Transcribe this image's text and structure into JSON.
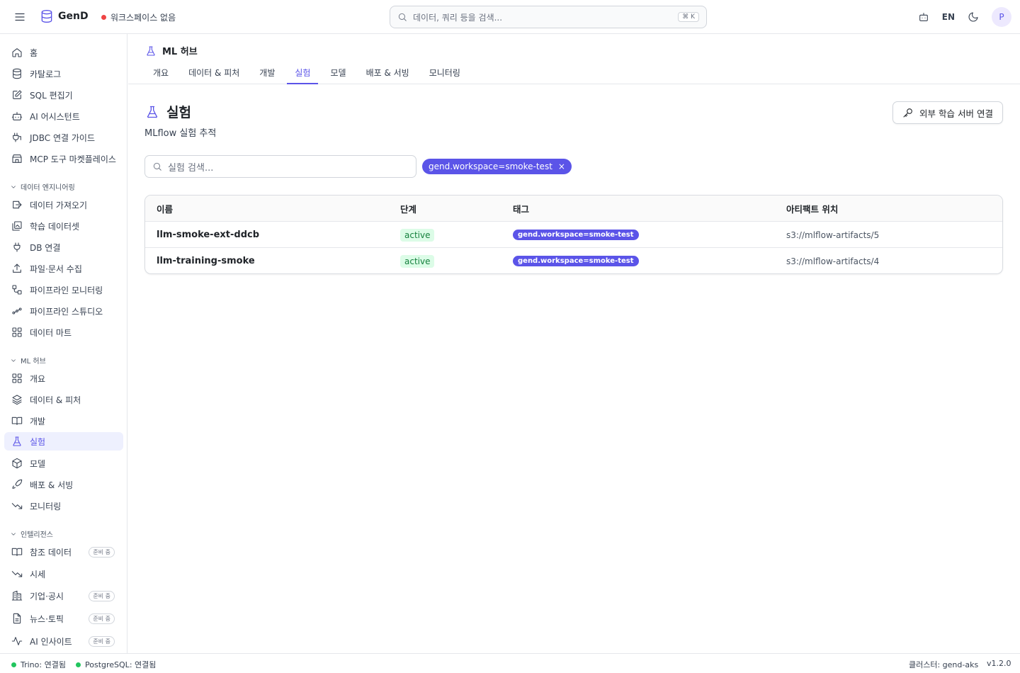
{
  "app": {
    "name": "GenD",
    "workspace_status": "워크스페이스 없음",
    "status_dot_color": "#ef4444",
    "brand_color": "#5b54e8"
  },
  "search": {
    "placeholder": "데이터, 쿼리 등을 검색...",
    "shortcut": "⌘ K"
  },
  "header_right": {
    "lang": "EN",
    "avatar_initial": "P"
  },
  "sidebar": {
    "top_items": [
      {
        "label": "홈",
        "icon": "home-icon"
      },
      {
        "label": "카탈로그",
        "icon": "database-icon"
      },
      {
        "label": "SQL 편집기",
        "icon": "edit-icon"
      },
      {
        "label": "AI 어시스턴트",
        "icon": "bot-icon"
      },
      {
        "label": "JDBC 연결 가이드",
        "icon": "plug-icon"
      },
      {
        "label": "MCP 도구 마켓플레이스",
        "icon": "store-icon"
      }
    ],
    "groups": [
      {
        "title": "데이터 엔지니어링",
        "items": [
          {
            "label": "데이터 가져오기"
          },
          {
            "label": "학습 데이터셋"
          },
          {
            "label": "DB 연결"
          },
          {
            "label": "파일·문서 수집"
          },
          {
            "label": "파이프라인 모니터링"
          },
          {
            "label": "파이프라인 스튜디오"
          },
          {
            "label": "데이터 마트"
          }
        ]
      },
      {
        "title": "ML 허브",
        "items": [
          {
            "label": "개요"
          },
          {
            "label": "데이터 & 피처"
          },
          {
            "label": "개발"
          },
          {
            "label": "실험"
          },
          {
            "label": "모델"
          },
          {
            "label": "배포 & 서빙"
          },
          {
            "label": "모니터링"
          }
        ]
      },
      {
        "title": "인텔리전스",
        "items": [
          {
            "label": "참조 데이터",
            "badge": "준비 중"
          },
          {
            "label": "시세"
          },
          {
            "label": "기업·공시",
            "badge": "준비 중"
          },
          {
            "label": "뉴스·토픽",
            "badge": "준비 중"
          },
          {
            "label": "AI 인사이트",
            "badge": "준비 중"
          }
        ]
      }
    ],
    "active": "실험"
  },
  "hub": {
    "title": "ML 허브",
    "tabs": [
      "개요",
      "데이터 & 피처",
      "개발",
      "실험",
      "모델",
      "배포 & 서빙",
      "모니터링"
    ],
    "active_tab": "실험"
  },
  "page": {
    "title": "실험",
    "subtitle": "MLflow 실험 추적",
    "external_button": "외부 학습 서버 연결",
    "search_placeholder": "실험 검색...",
    "filter_chip": "gend.workspace=smoke-test",
    "filter_close": "×"
  },
  "table": {
    "columns": [
      "이름",
      "단계",
      "태그",
      "아티팩트 위치"
    ],
    "rows": [
      {
        "name": "llm-smoke-ext-ddcb",
        "stage": "active",
        "tag": "gend.workspace=smoke-test",
        "artifact": "s3://mlflow-artifacts/5"
      },
      {
        "name": "llm-training-smoke",
        "stage": "active",
        "tag": "gend.workspace=smoke-test",
        "artifact": "s3://mlflow-artifacts/4"
      }
    ]
  },
  "statusbar": {
    "trino": "Trino: 연결됨",
    "postgres": "PostgreSQL: 연결됨",
    "connected_color": "#22c55e",
    "cluster": "클러스터: gend-aks",
    "version": "v1.2.0"
  }
}
